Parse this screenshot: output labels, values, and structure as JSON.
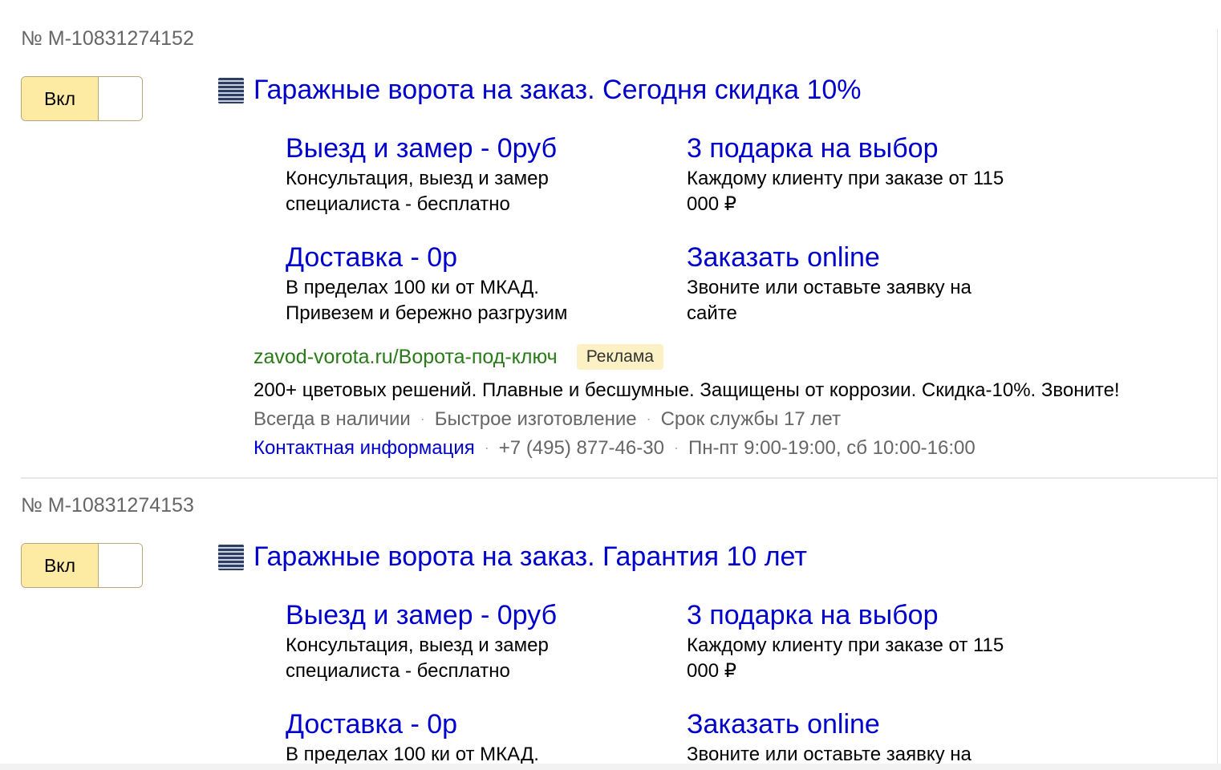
{
  "ads": [
    {
      "number": "№ M-10831274152",
      "toggle_label": "Вкл",
      "title": "Гаражные ворота на заказ. Сегодня скидка 10%",
      "sitelinks": [
        {
          "title": "Выезд и замер - 0руб",
          "desc": "Консультация, выезд и замер специалиста - бесплатно"
        },
        {
          "title": "3 подарка на выбор",
          "desc": "Каждому клиенту при заказе от 115 000 ₽"
        },
        {
          "title": "Доставка - 0р",
          "desc": "В пределах 100 ки от МКАД. Привезем и бережно разгрузим"
        },
        {
          "title": "Заказать online",
          "desc": "Звоните или оставьте заявку на сайте"
        }
      ],
      "url": "zavod-vorota.ru/Ворота-под-ключ",
      "badge": "Реклама",
      "text": "200+ цветовых решений. Плавные и бесшумные. Защищены от коррозии. Скидка-10%. Звоните!",
      "callouts": [
        "Всегда в наличии",
        "Быстрое изготовление",
        "Срок службы 17 лет"
      ],
      "contacts": {
        "link_label": "Контактная информация",
        "phone": "+7 (495) 877-46-30",
        "hours": "Пн-пт 9:00-19:00, сб 10:00-16:00"
      },
      "separator": "·"
    },
    {
      "number": "№ M-10831274153",
      "toggle_label": "Вкл",
      "title": "Гаражные ворота на заказ. Гарантия 10 лет",
      "sitelinks": [
        {
          "title": "Выезд и замер - 0руб",
          "desc": "Консультация, выезд и замер специалиста - бесплатно"
        },
        {
          "title": "3 подарка на выбор",
          "desc": "Каждому клиенту при заказе от 115 000 ₽"
        },
        {
          "title": "Доставка - 0р",
          "desc": "В пределах 100 ки от МКАД."
        },
        {
          "title": "Заказать online",
          "desc": "Звоните или оставьте заявку на"
        }
      ]
    }
  ],
  "colors": {
    "link": "#0000cc",
    "url": "#2a7a1a",
    "toggle_on_bg": "#feeba3",
    "badge_bg": "#fbf1c5",
    "muted_text": "#666666"
  },
  "icons": {
    "favicon": "striped-logo-icon"
  }
}
